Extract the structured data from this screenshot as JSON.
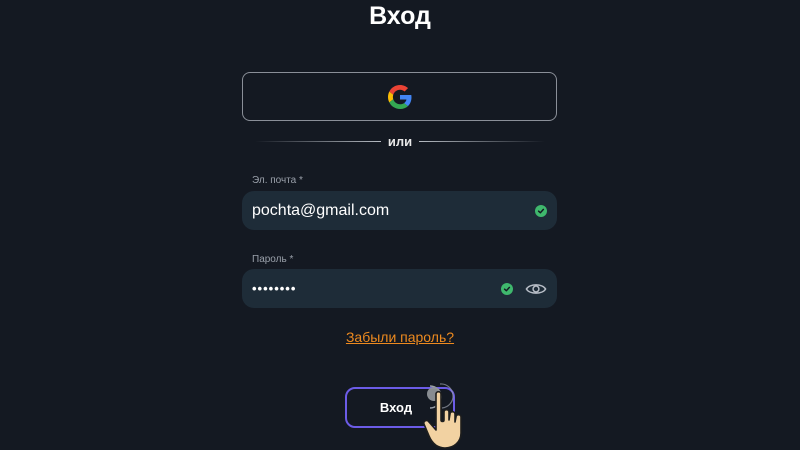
{
  "title": "Вход",
  "google_button": {
    "icon": "google-logo-icon"
  },
  "divider": {
    "text": "или"
  },
  "email": {
    "label": "Эл. почта *",
    "value": "pochta@gmail.com",
    "valid_icon": "check-circle-icon"
  },
  "password": {
    "label": "Пароль *",
    "value": "••••••••",
    "valid_icon": "check-circle-icon",
    "toggle_icon": "eye-icon"
  },
  "forgot_link": "Забыли пароль?",
  "login_button": "Вход",
  "colors": {
    "background": "#141922",
    "field": "#1e2c38",
    "link": "#ee8a1f",
    "button_border": "#6c5ce7",
    "valid": "#3fb86d"
  }
}
